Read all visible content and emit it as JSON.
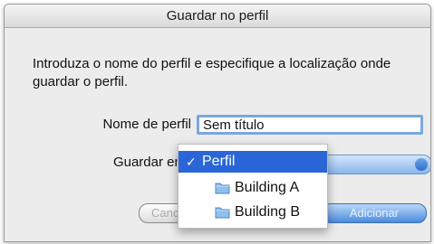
{
  "dialog": {
    "title": "Guardar no perfil",
    "message": "Introduza o nome do perfil e especifique a localização onde guardar o perfil.",
    "name_label": "Nome de perfil",
    "name_value": "Sem título",
    "save_label": "Guardar em",
    "cancel_label": "Cancelar",
    "add_label": "Adicionar"
  },
  "menu": {
    "selected_label": "Perfil",
    "items": [
      {
        "label": "Building A",
        "icon": "folder-icon"
      },
      {
        "label": "Building B",
        "icon": "folder-icon"
      }
    ]
  },
  "colors": {
    "selection": "#2a66d8",
    "focus_ring": "#7aa7e0",
    "folder": "#8fc0ec"
  }
}
